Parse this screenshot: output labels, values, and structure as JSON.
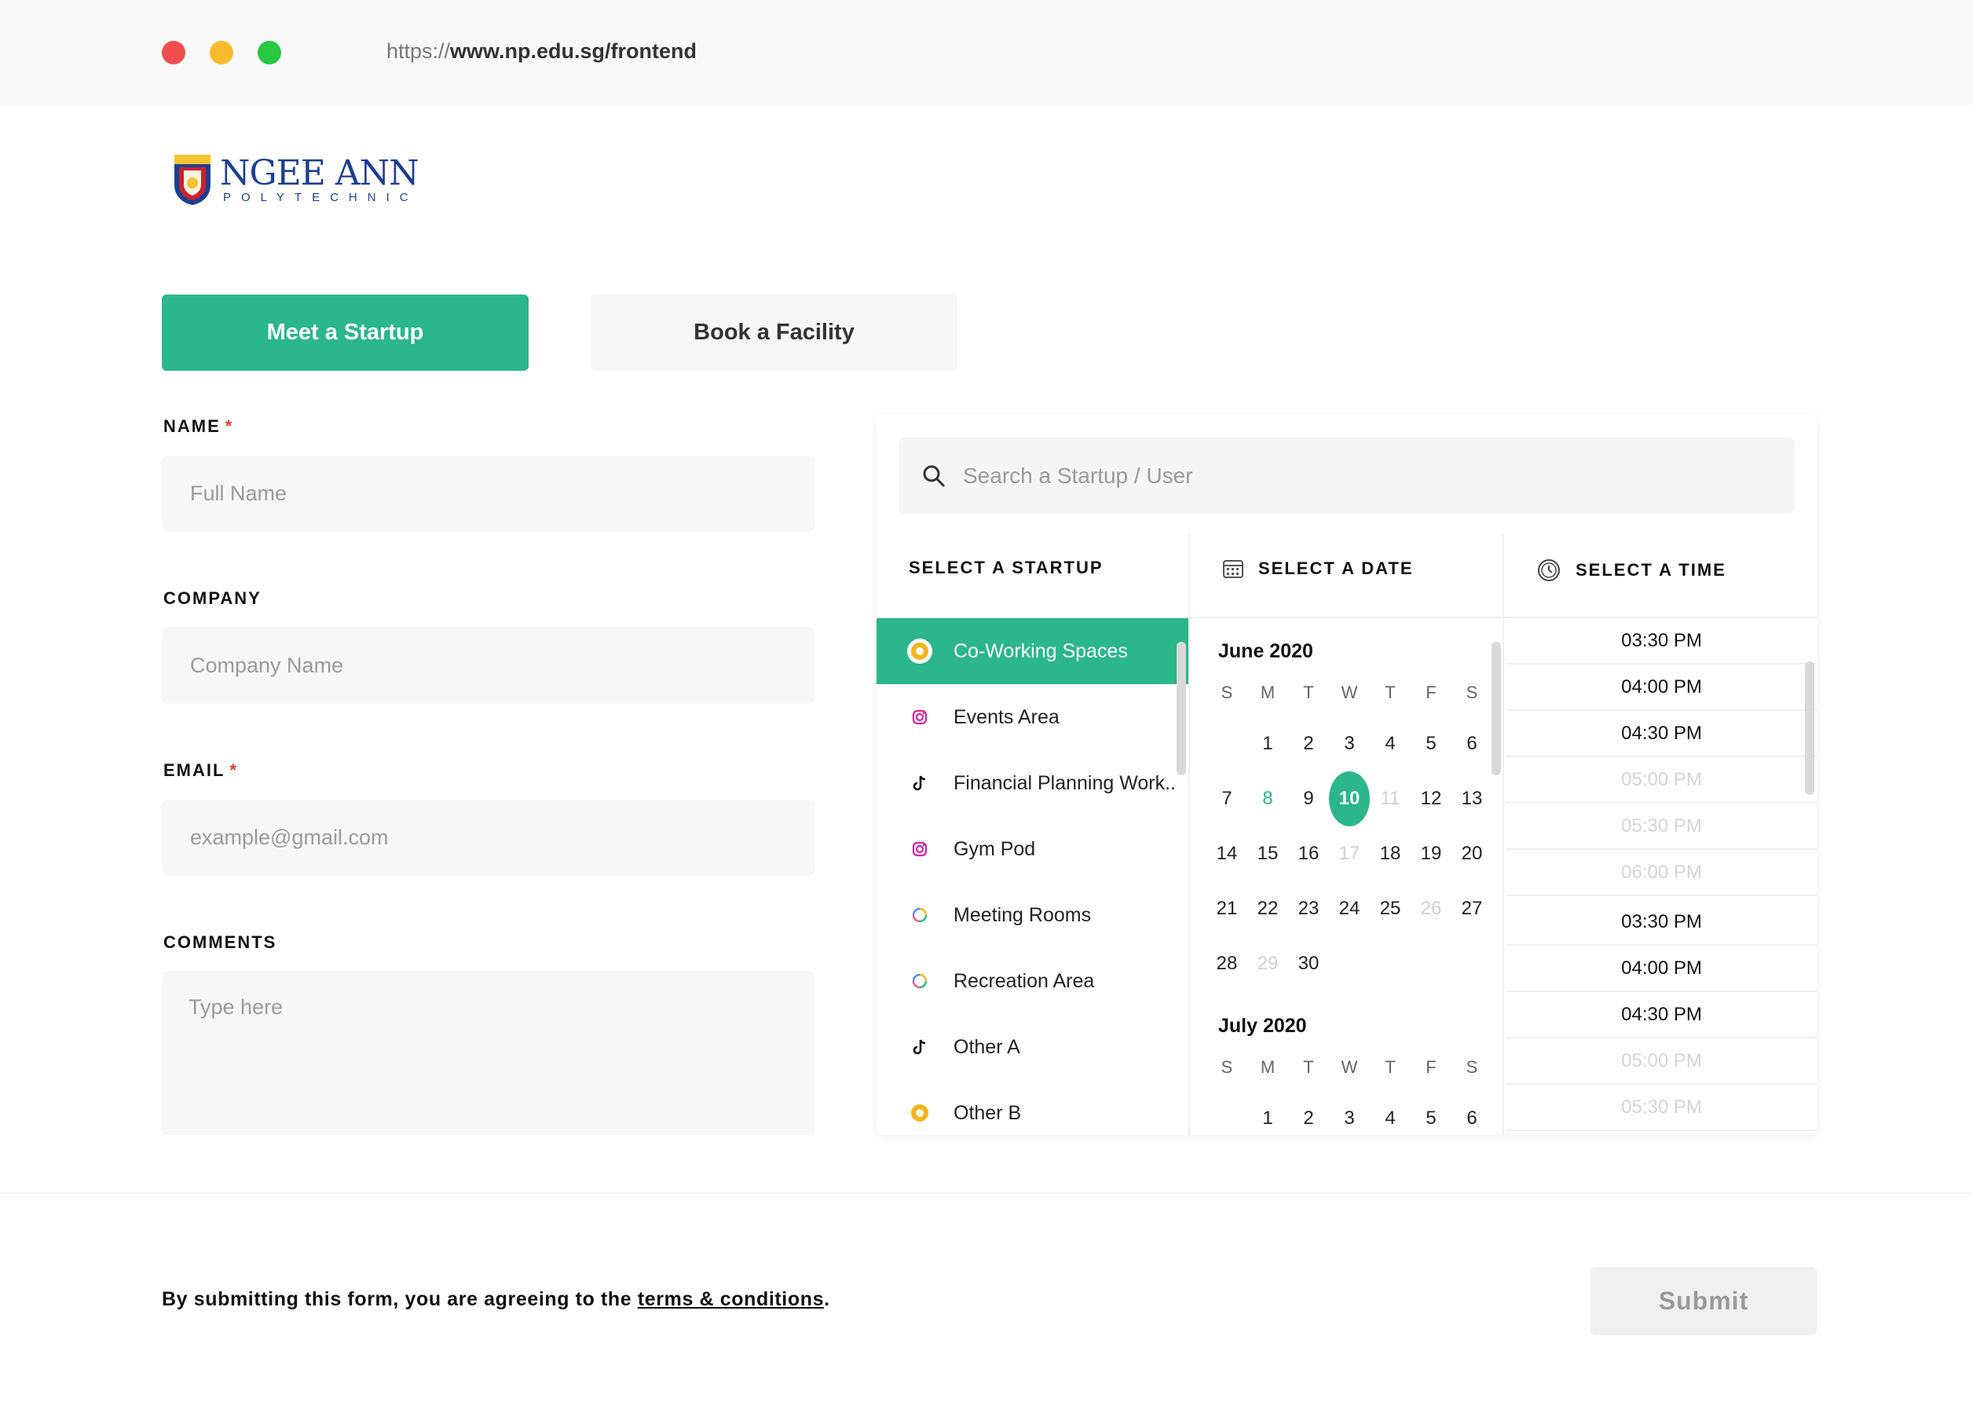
{
  "browser": {
    "url_scheme": "https://",
    "url_host": "www.np.edu.sg/frontend",
    "dot_colors": [
      "#f04e4e",
      "#f8bb2b",
      "#28c840"
    ]
  },
  "logo": {
    "name": "NGEE ANN",
    "sub": "POLYTECHNIC"
  },
  "tabs": {
    "meet": "Meet a Startup",
    "book": "Book a Facility"
  },
  "form": {
    "name_label": "NAME",
    "name_placeholder": "Full Name",
    "company_label": "COMPANY",
    "company_placeholder": "Company Name",
    "email_label": "EMAIL",
    "email_placeholder": "example@gmail.com",
    "comments_label": "COMMENTS",
    "comments_placeholder": "Type here",
    "required_mark": "*"
  },
  "panel": {
    "search_placeholder": "Search a Startup / User",
    "startup_header": "SELECT A STARTUP",
    "date_header": "SELECT A DATE",
    "time_header": "SELECT A TIME",
    "startups": [
      {
        "label": "Co-Working Spaces",
        "icon": "yellow-circle-icon",
        "active": true
      },
      {
        "label": "Events Area",
        "icon": "instagram-icon",
        "active": false
      },
      {
        "label": "Financial Planning Work..",
        "icon": "tiktok-icon",
        "active": false
      },
      {
        "label": "Gym Pod",
        "icon": "instagram-icon",
        "active": false
      },
      {
        "label": "Meeting Rooms",
        "icon": "pinwheel-icon",
        "active": false
      },
      {
        "label": "Recreation Area",
        "icon": "pinwheel-icon",
        "active": false
      },
      {
        "label": "Other A",
        "icon": "tiktok-icon",
        "active": false
      },
      {
        "label": "Other B",
        "icon": "yellow-circle-icon",
        "active": false
      }
    ],
    "weekdays": [
      "S",
      "M",
      "T",
      "W",
      "T",
      "F",
      "S"
    ],
    "months": [
      {
        "title": "June 2020",
        "days": [
          [
            "",
            "1",
            "2",
            "3",
            "4",
            "5",
            "6"
          ],
          [
            "7",
            "8",
            "9",
            "10",
            "11",
            "12",
            "13"
          ],
          [
            "14",
            "15",
            "16",
            "17",
            "18",
            "19",
            "20"
          ],
          [
            "21",
            "22",
            "23",
            "24",
            "25",
            "26",
            "27"
          ],
          [
            "28",
            "29",
            "30",
            "",
            "",
            "",
            ""
          ]
        ],
        "selected": "10",
        "highlighted": [
          "8"
        ],
        "disabled": [
          "11",
          "17",
          "26",
          "29"
        ]
      },
      {
        "title": "July 2020",
        "days": [
          [
            "",
            "1",
            "2",
            "3",
            "4",
            "5",
            "6"
          ]
        ],
        "selected": "",
        "highlighted": [],
        "disabled": []
      }
    ],
    "times": [
      {
        "label": "03:30 PM",
        "disabled": false
      },
      {
        "label": "04:00 PM",
        "disabled": false
      },
      {
        "label": "04:30 PM",
        "disabled": false
      },
      {
        "label": "05:00 PM",
        "disabled": true
      },
      {
        "label": "05:30 PM",
        "disabled": true
      },
      {
        "label": "06:00 PM",
        "disabled": true
      },
      {
        "label": "03:30 PM",
        "disabled": false
      },
      {
        "label": "04:00 PM",
        "disabled": false
      },
      {
        "label": "04:30 PM",
        "disabled": false
      },
      {
        "label": "05:00 PM",
        "disabled": true
      },
      {
        "label": "05:30 PM",
        "disabled": true
      }
    ]
  },
  "footer": {
    "terms_prefix": "By submitting this form, you are agreeing to the ",
    "terms_link": "terms & conditions",
    "terms_suffix": ".",
    "submit": "Submit"
  },
  "colors": {
    "accent": "#2bb68c",
    "required": "#e53935"
  }
}
